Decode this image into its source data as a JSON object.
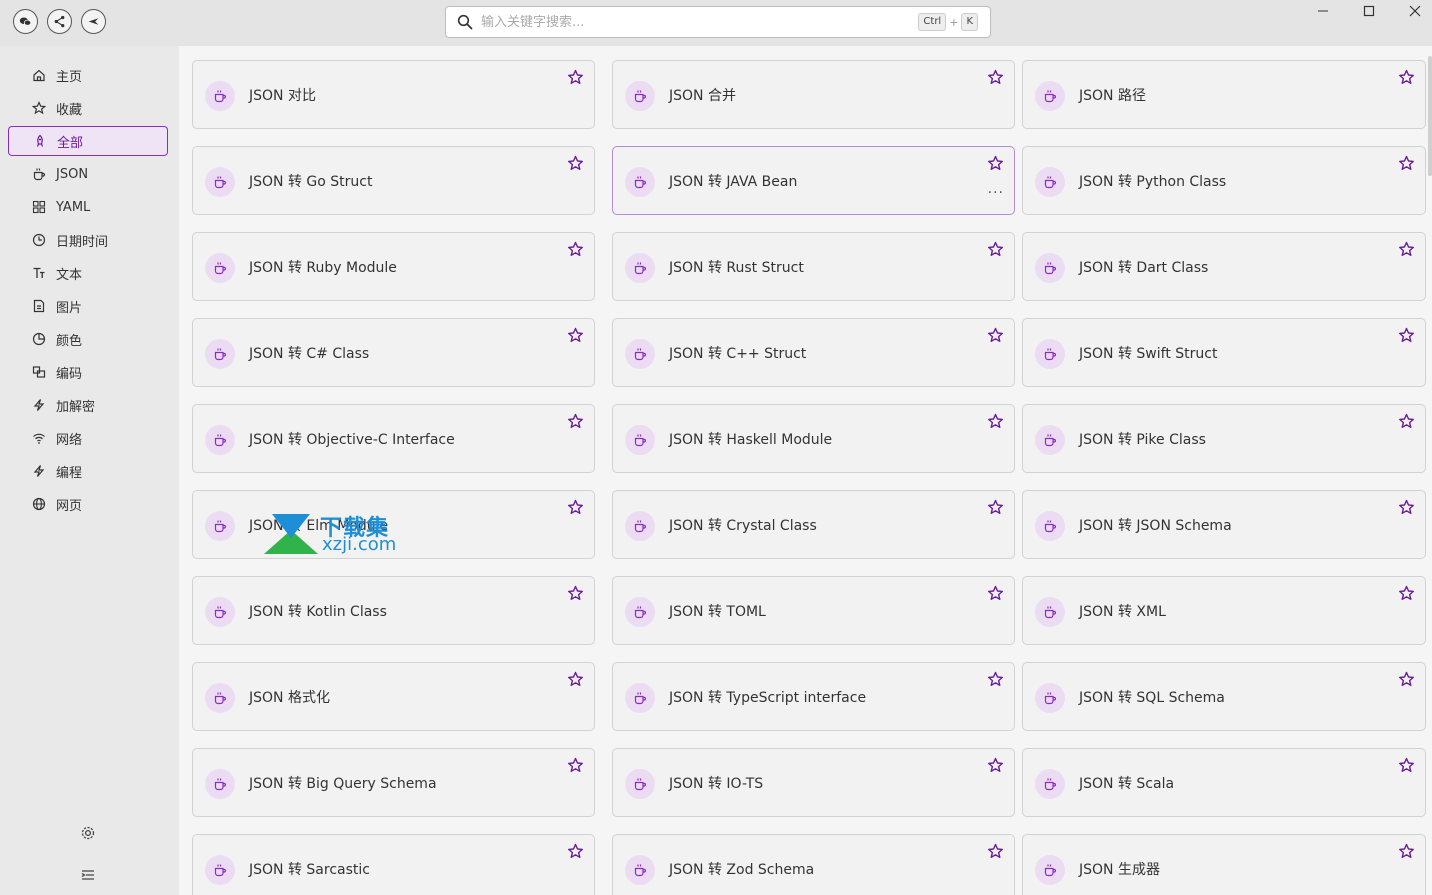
{
  "search": {
    "placeholder": "输入关键字搜索...",
    "shortcut_ctrl": "Ctrl",
    "shortcut_plus": "+",
    "shortcut_key": "K"
  },
  "sidebar": {
    "items": [
      {
        "label": "主页",
        "icon": "home-icon"
      },
      {
        "label": "收藏",
        "icon": "star-icon"
      },
      {
        "label": "全部",
        "icon": "rocket-icon",
        "active": true
      },
      {
        "label": "JSON",
        "icon": "cup-icon"
      },
      {
        "label": "YAML",
        "icon": "grid-icon"
      },
      {
        "label": "日期时间",
        "icon": "clock-icon"
      },
      {
        "label": "文本",
        "icon": "text-icon"
      },
      {
        "label": "图片",
        "icon": "image-icon"
      },
      {
        "label": "颜色",
        "icon": "palette-icon"
      },
      {
        "label": "编码",
        "icon": "code-icon"
      },
      {
        "label": "加解密",
        "icon": "lightning-icon"
      },
      {
        "label": "网络",
        "icon": "wifi-icon"
      },
      {
        "label": "编程",
        "icon": "lightning-icon"
      },
      {
        "label": "网页",
        "icon": "globe-icon"
      }
    ]
  },
  "tools": [
    "JSON 对比",
    "JSON 合并",
    "JSON 路径",
    "JSON 转 Go Struct",
    "JSON 转 JAVA Bean",
    "JSON 转 Python Class",
    "JSON 转 Ruby Module",
    "JSON 转 Rust Struct",
    "JSON 转 Dart Class",
    "JSON 转 C# Class",
    "JSON 转 C++ Struct",
    "JSON 转 Swift Struct",
    "JSON 转 Objective-C Interface",
    "JSON 转 Haskell Module",
    "JSON 转 Pike Class",
    "JSON 转 Elm Module",
    "JSON 转 Crystal Class",
    "JSON 转 JSON Schema",
    "JSON 转 Kotlin Class",
    "JSON 转 TOML",
    "JSON 转 XML",
    "JSON 格式化",
    "JSON 转 TypeScript interface",
    "JSON 转 SQL Schema",
    "JSON 转 Big Query Schema",
    "JSON 转 IO-TS",
    "JSON 转 Scala",
    "JSON 转 Sarcastic",
    "JSON 转 Zod Schema",
    "JSON 生成器"
  ],
  "hovered_card_more": "···",
  "watermark": {
    "line1": "下载集",
    "line2": "xzji.com"
  },
  "colors": {
    "accent": "#8a2bc2",
    "accent_bg": "#efe4f6",
    "icon_bg": "#ecdcf3"
  }
}
